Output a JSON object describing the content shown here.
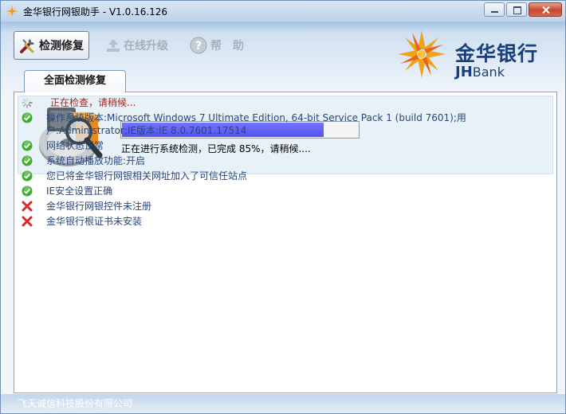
{
  "window": {
    "title": "金华银行网银助手 - V1.0.16.126"
  },
  "toolbar": {
    "repair_label": "检测修复",
    "upgrade_label": "在线升级",
    "help_label": "帮　助"
  },
  "logo": {
    "cn": "金华银行",
    "en_bold": "JH",
    "en_rest": "Bank"
  },
  "tab": {
    "label": "全面检测修复"
  },
  "progress": {
    "percent": 85,
    "text": "正在进行系统检测，已完成  85%，请稍候...."
  },
  "checks": [
    {
      "status": "busy",
      "text": "正在检查，请稍候..."
    },
    {
      "status": "ok",
      "text": "操作系统版本:Microsoft Windows 7 Ultimate Edition, 64-bit Service Pack 1 (build 7601);用户:Administrator;IE版本:IE 8.0.7601.17514"
    },
    {
      "status": "ok",
      "text": "网络状态正常"
    },
    {
      "status": "ok",
      "text": "系统自动播放功能:开启"
    },
    {
      "status": "ok",
      "text": "您已将金华银行网银相关网址加入了可信任站点"
    },
    {
      "status": "ok",
      "text": "IE安全设置正确"
    },
    {
      "status": "fail",
      "text": "金华银行网银控件未注册"
    },
    {
      "status": "fail",
      "text": "金华银行根证书未安装"
    }
  ],
  "footer": {
    "company": "飞天诚信科技股份有限公司"
  },
  "colors": {
    "progress_fill": "#6464f8",
    "ok_green": "#3cae2e",
    "fail_red": "#d42a2a",
    "busy_text": "#a0271b"
  }
}
